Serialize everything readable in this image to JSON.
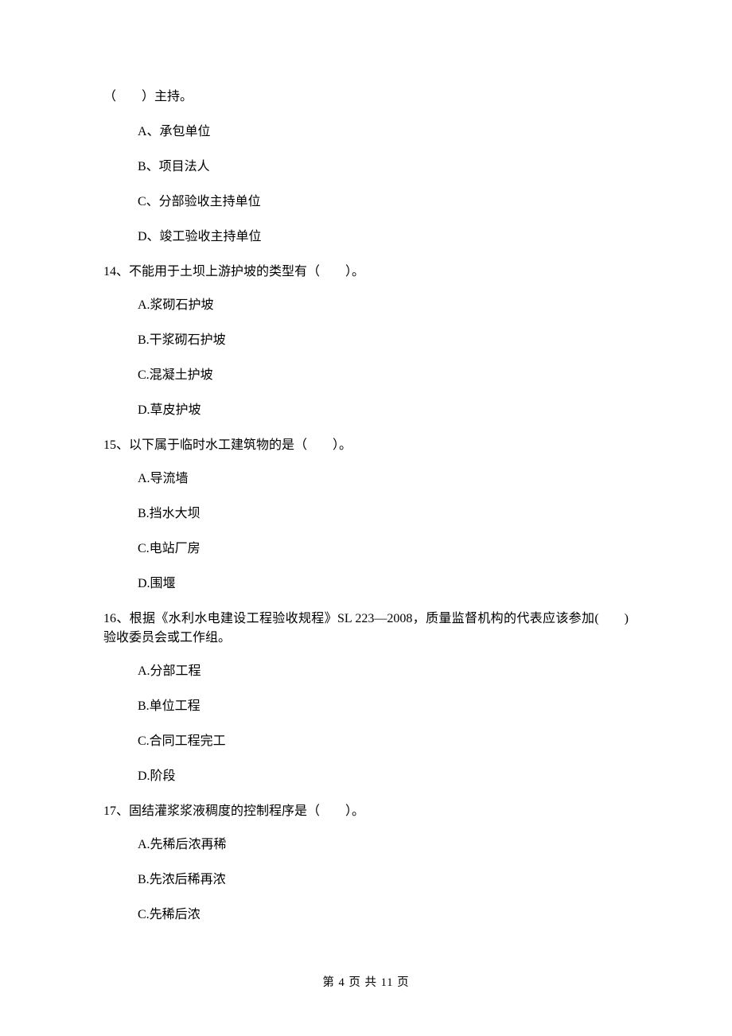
{
  "q13_tail": {
    "prefix": "（",
    "blank": "　　",
    "suffix": "）主持。"
  },
  "q13_options": {
    "A": "A、承包单位",
    "B": "B、项目法人",
    "C": "C、分部验收主持单位",
    "D": "D、竣工验收主持单位"
  },
  "q14": {
    "stem_prefix": "14、不能用于土坝上游护坡的类型有（",
    "stem_blank": "　　",
    "stem_suffix": "）。",
    "options": {
      "A": "A.浆砌石护坡",
      "B": "B.干浆砌石护坡",
      "C": "C.混凝土护坡",
      "D": "D.草皮护坡"
    }
  },
  "q15": {
    "stem_prefix": "15、以下属于临时水工建筑物的是（",
    "stem_blank": "　　",
    "stem_suffix": "）。",
    "options": {
      "A": "A.导流墙",
      "B": "B.挡水大坝",
      "C": "C.电站厂房",
      "D": "D.围堰"
    }
  },
  "q16": {
    "stem_prefix": "16、根据《水利水电建设工程验收规程》SL 223—2008，质量监督机构的代表应该参加(",
    "stem_blank": "　　",
    "stem_suffix": ")验收委员会或工作组。",
    "options": {
      "A": "A.分部工程",
      "B": "B.单位工程",
      "C": "C.合同工程完工",
      "D": "D.阶段"
    }
  },
  "q17": {
    "stem_prefix": "17、固结灌浆浆液稠度的控制程序是（",
    "stem_blank": "　　",
    "stem_suffix": "）。",
    "options": {
      "A": "A.先稀后浓再稀",
      "B": "B.先浓后稀再浓",
      "C": "C.先稀后浓"
    }
  },
  "footer": "第 4 页 共 11 页"
}
